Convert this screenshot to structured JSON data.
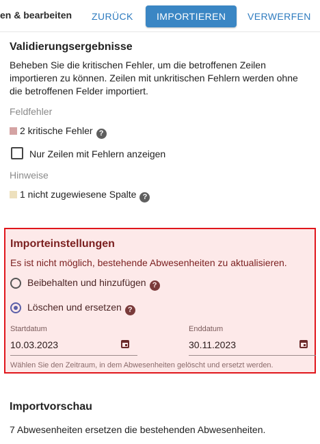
{
  "toolbar": {
    "breadcrumb": "en & bearbeiten",
    "back_label": "ZURÜCK",
    "import_label": "IMPORTIEREN",
    "discard_label": "VERWERFEN"
  },
  "validation": {
    "title": "Validierungsergebnisse",
    "description_lines": [
      "Beheben Sie die kritischen Fehler, um die betroffenen Zeilen",
      "importieren zu können. Zeilen mit unkritischen Fehlern werden ohne",
      "die betroffenen Felder importiert."
    ],
    "field_errors_heading": "Feldfehler",
    "critical_errors": "2 kritische Fehler",
    "critical_color": "#d4a3a3",
    "only_rows_with_errors": "Nur Zeilen mit Fehlern anzeigen",
    "only_rows_checked": false,
    "hints_heading": "Hinweise",
    "unassigned_columns": "1 nicht zugewiesene Spalte",
    "hint_color": "#ede0bd"
  },
  "import_settings": {
    "title": "Importeinstellungen",
    "warning": "Es ist nicht möglich, bestehende Abwesenheiten zu aktualisieren.",
    "options": [
      {
        "label": "Beibehalten und hinzufügen",
        "selected": false
      },
      {
        "label": "Löschen und ersetzen",
        "selected": true
      }
    ],
    "start_label": "Startdatum",
    "start_value": "10.03.2023",
    "end_label": "Enddatum",
    "end_value": "30.11.2023",
    "helper": "Wählen Sie den Zeitraum, in dem Abwesenheiten gelöscht und ersetzt werden.",
    "error_border_color": "#e0151b"
  },
  "preview": {
    "title": "Importvorschau",
    "text": "7 Abwesenheiten ersetzen die bestehenden Abwesenheiten."
  },
  "icons": {
    "help": "help-circle-icon",
    "calendar": "calendar-icon"
  }
}
